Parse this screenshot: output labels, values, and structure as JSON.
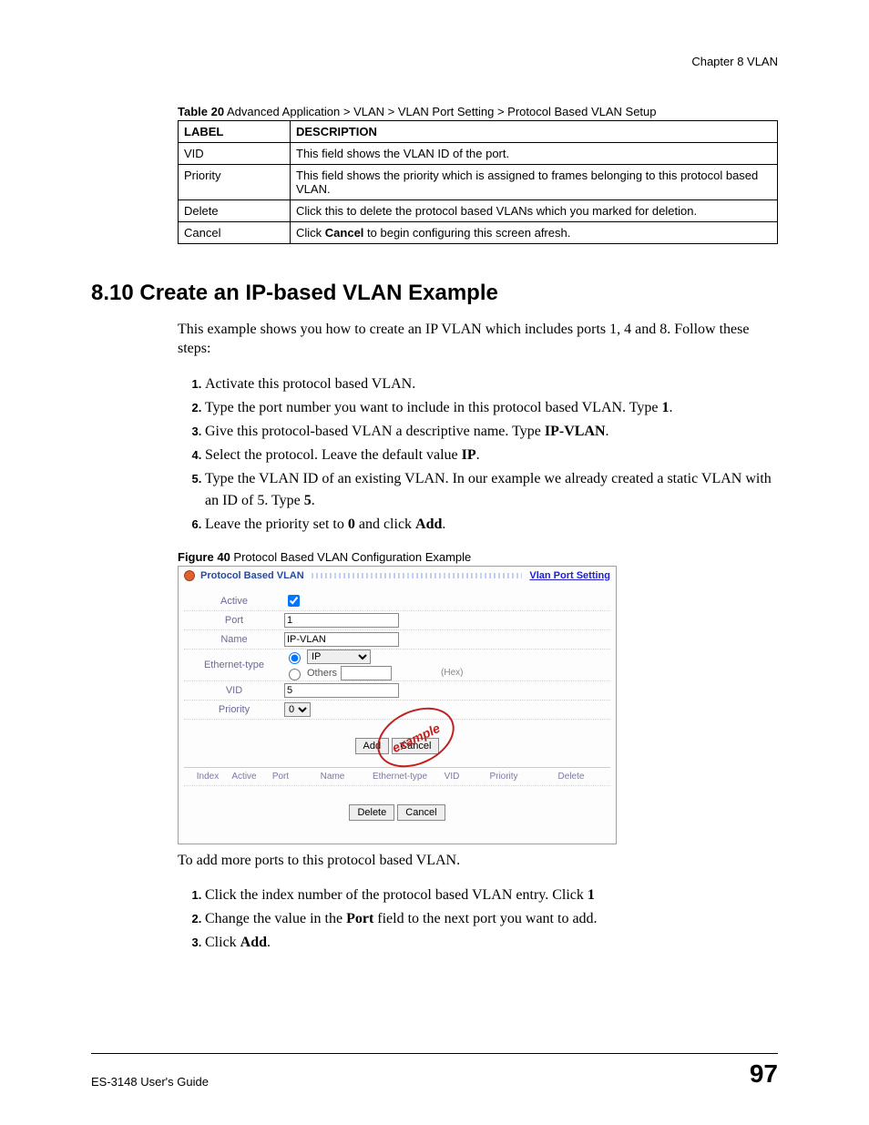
{
  "chapter_header": "Chapter 8 VLAN",
  "table20": {
    "caption_bold": "Table 20",
    "caption_rest": "   Advanced Application > VLAN > VLAN Port Setting > Protocol Based VLAN Setup",
    "head_label": "LABEL",
    "head_desc": "DESCRIPTION",
    "rows": [
      {
        "label": "VID",
        "desc": "This field shows the VLAN ID of the port."
      },
      {
        "label": "Priority",
        "desc": "This field shows the priority which is assigned to frames belonging to this protocol based VLAN."
      },
      {
        "label": "Delete",
        "desc": "Click this to delete the protocol based VLANs which you marked for deletion."
      },
      {
        "label": "Cancel",
        "desc_pre": "Click ",
        "desc_bold": "Cancel",
        "desc_post": " to begin configuring this screen afresh."
      }
    ]
  },
  "section_heading": "8.10  Create an IP-based VLAN Example",
  "intro": "This example shows you how to create an IP VLAN which includes ports 1, 4 and 8. Follow these steps:",
  "steps1": [
    {
      "t": "Activate this protocol based VLAN."
    },
    {
      "pre": "Type the port number you want to include in this protocol based VLAN. Type ",
      "b": "1",
      "post": "."
    },
    {
      "pre": "Give this protocol-based VLAN a descriptive name. Type ",
      "b": "IP-VLAN",
      "post": "."
    },
    {
      "pre": "Select the protocol. Leave the default value ",
      "b": "IP",
      "post": "."
    },
    {
      "pre": "Type the VLAN ID of an existing VLAN. In our example we already created a static VLAN with an ID of 5. Type ",
      "b": "5",
      "post": "."
    },
    {
      "pre": "Leave the priority set to ",
      "b": "0",
      "post1": " and click ",
      "b2": "Add",
      "post2": "."
    }
  ],
  "figure40": {
    "caption_bold": "Figure 40",
    "caption_rest": "   Protocol Based VLAN Configuration Example"
  },
  "gui": {
    "title": "Protocol Based VLAN",
    "link": "Vlan Port Setting",
    "labels": {
      "active": "Active",
      "port": "Port",
      "name": "Name",
      "etype": "Ethernet-type",
      "vid": "VID",
      "priority": "Priority"
    },
    "values": {
      "port": "1",
      "name": "IP-VLAN",
      "etype_select": "IP",
      "others": "Others",
      "hex": "(Hex)",
      "vid": "5",
      "priority": "0"
    },
    "buttons": {
      "add": "Add",
      "cancel": "Cancel",
      "delete": "Delete"
    },
    "listhead": [
      "Index",
      "Active",
      "Port",
      "Name",
      "Ethernet-type",
      "VID",
      "Priority",
      "Delete"
    ],
    "stamp": "example"
  },
  "after_figure": "To add more ports to this protocol based VLAN.",
  "steps2": [
    {
      "pre": "Click the index number of the protocol based VLAN entry. Click ",
      "b": "1"
    },
    {
      "pre": "Change the value in the ",
      "b": "Port",
      "post": " field to the next port you want to add."
    },
    {
      "pre": "Click ",
      "b": "Add",
      "post": "."
    }
  ],
  "footer": {
    "guide": "ES-3148 User's Guide",
    "page": "97"
  }
}
